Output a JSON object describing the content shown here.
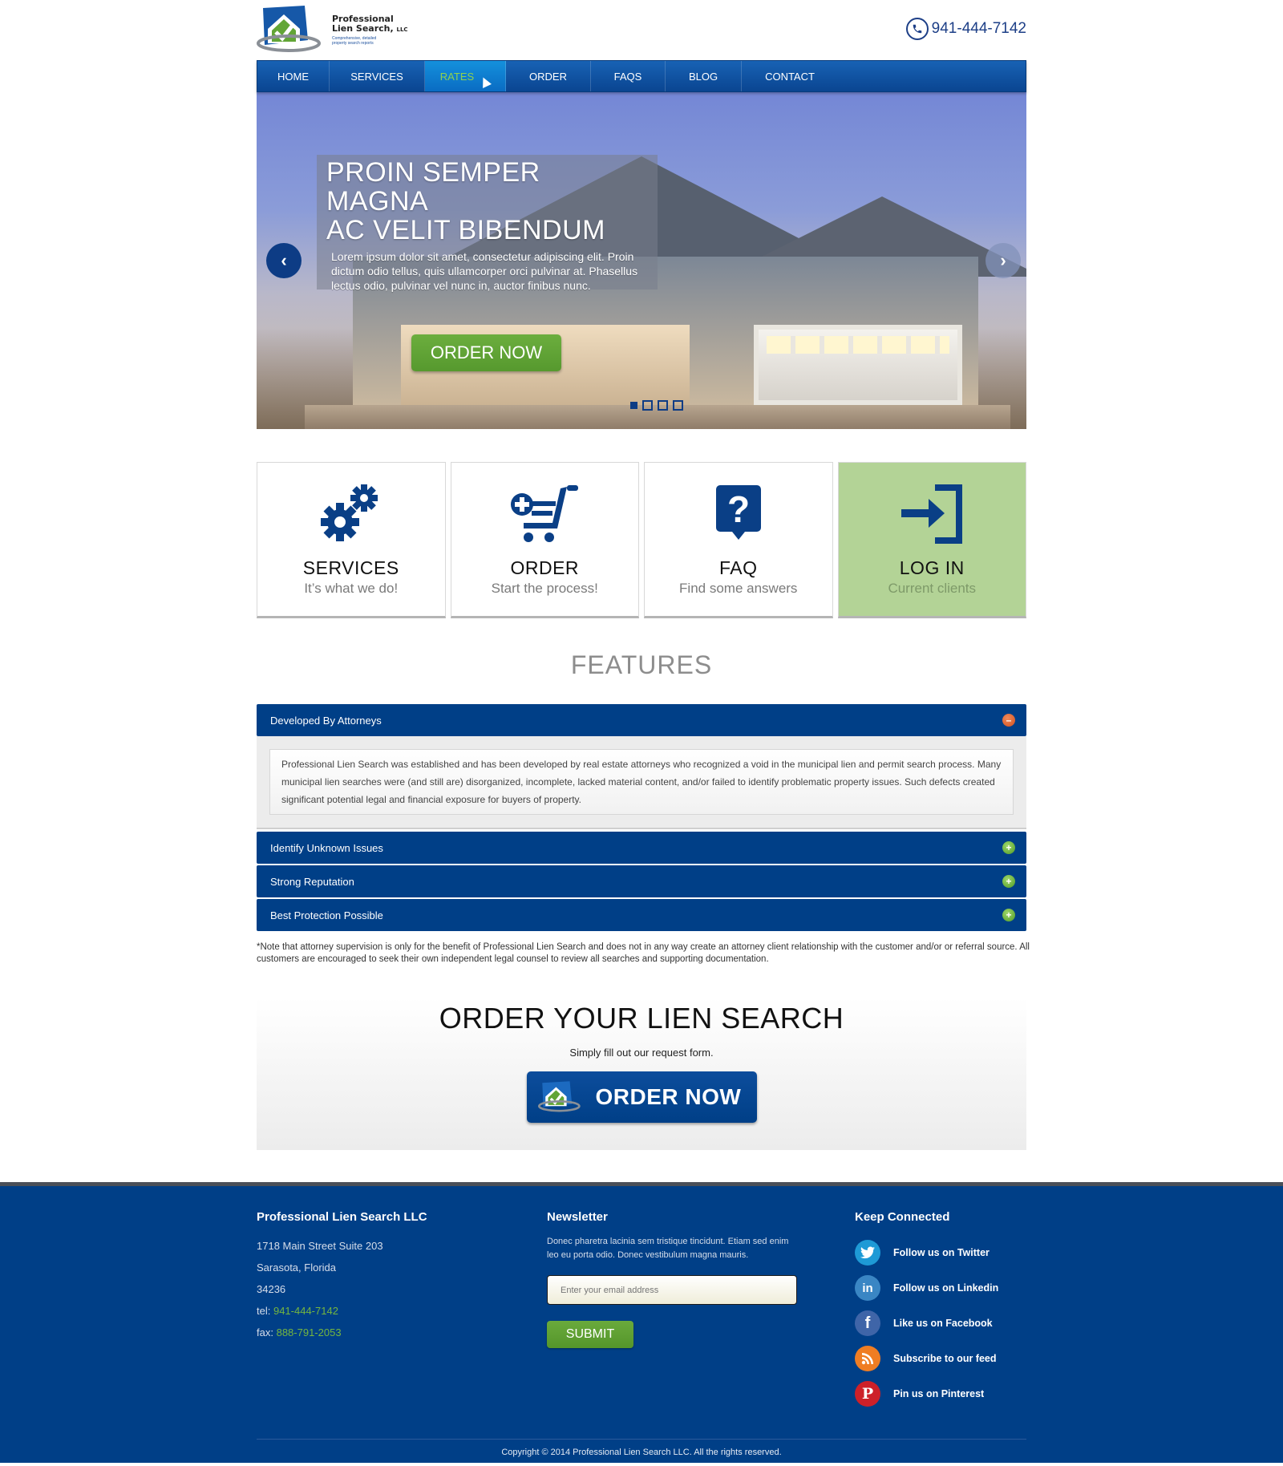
{
  "header": {
    "logo": {
      "name_line1": "Professional",
      "name_line2": "Lien Search,",
      "name_suffix": "LLC",
      "tagline": "Comprehensive, detailed property search reports"
    },
    "phone": "941-444-7142"
  },
  "nav": {
    "items": [
      {
        "label": "HOME",
        "active": false
      },
      {
        "label": "SERVICES",
        "active": false
      },
      {
        "label": "RATES",
        "active": true
      },
      {
        "label": "ORDER",
        "active": false
      },
      {
        "label": "FAQS",
        "active": false
      },
      {
        "label": "BLOG",
        "active": false
      },
      {
        "label": "CONTACT",
        "active": false
      }
    ]
  },
  "hero": {
    "title_line1": "PROIN SEMPER MAGNA",
    "title_line2": "AC VELIT BIBENDUM",
    "text": "Lorem ipsum dolor sit amet, consectetur adipiscing elit. Proin dictum odio tellus, quis ullamcorper orci pulvinar at. Phasellus lectus odio, pulvinar vel nunc in, auctor finibus nunc.",
    "button": "ORDER NOW",
    "prev_icon": "chevron-left-icon",
    "next_icon": "chevron-right-icon",
    "slides_total": 4,
    "active_slide": 1
  },
  "tiles": [
    {
      "title": "SERVICES",
      "subtitle": "It’s what we do!",
      "icon": "gears-icon",
      "active": false
    },
    {
      "title": "ORDER",
      "subtitle": "Start the process!",
      "icon": "cart-plus-icon",
      "active": false
    },
    {
      "title": "FAQ",
      "subtitle": "Find some answers",
      "icon": "question-bubble-icon",
      "active": false
    },
    {
      "title": "LOG IN",
      "subtitle": "Current clients",
      "icon": "login-icon",
      "active": true
    }
  ],
  "features": {
    "title": "FEATURES",
    "items": [
      {
        "label": "Developed By Attorneys",
        "expanded": true,
        "body": "Professional Lien Search was established and has been developed by real estate attorneys who recognized a void in the municipal lien and permit search process. Many municipal lien searches were (and still are) disorganized, incomplete, lacked material content, and/or failed to identify problematic property issues. Such defects created significant potential legal and financial exposure for buyers of property."
      },
      {
        "label": "Identify Unknown Issues",
        "expanded": false
      },
      {
        "label": "Strong Reputation",
        "expanded": false
      },
      {
        "label": "Best Protection Possible",
        "expanded": false
      }
    ],
    "note": "*Note that attorney supervision is only for the benefit of Professional Lien Search and does not in any way create an attorney client relationship with the customer and/or or referral source. All customers are encouraged to seek their own independent legal counsel to review all searches and supporting documentation."
  },
  "cta": {
    "title": "ORDER YOUR LIEN SEARCH",
    "subtitle": "Simply fill out our request form.",
    "button": "ORDER NOW"
  },
  "footer": {
    "company": {
      "heading": "Professional Lien Search LLC",
      "address1": "1718 Main Street Suite 203",
      "address2": "Sarasota, Florida",
      "zip": "34236",
      "tel_label": "tel:",
      "tel": "941-444-7142",
      "fax_label": "fax:",
      "fax": "888-791-2053"
    },
    "newsletter": {
      "heading": "Newsletter",
      "text": "Donec pharetra lacinia sem tristique tincidunt. Etiam sed enim leo eu porta odio. Donec vestibulum magna mauris.",
      "email_placeholder": "Enter your email address",
      "email_value": "",
      "submit": "SUBMIT"
    },
    "social": {
      "heading": "Keep Connected",
      "items": [
        {
          "label": "Follow us on Twitter",
          "icon": "twitter-icon",
          "color": "#1e9ad6",
          "glyph": "t"
        },
        {
          "label": "Follow us on Linkedin",
          "icon": "linkedin-icon",
          "color": "#3a86c4",
          "glyph": "in"
        },
        {
          "label": "Like us on Facebook",
          "icon": "facebook-icon",
          "color": "#3f65a8",
          "glyph": "f"
        },
        {
          "label": "Subscribe to our feed",
          "icon": "rss-icon",
          "color": "#ef7d23",
          "glyph": "◣"
        },
        {
          "label": "Pin us on Pinterest",
          "icon": "pinterest-icon",
          "color": "#cd2029",
          "glyph": "P"
        }
      ]
    },
    "copyright": "Copyright © 2014 Professional Lien Search LLC. All the rights reserved."
  },
  "colors": {
    "brand_blue": "#003f87",
    "accent_green": "#62a536",
    "login_tile": "#b3d396",
    "footer_link_green": "#74b63f"
  }
}
